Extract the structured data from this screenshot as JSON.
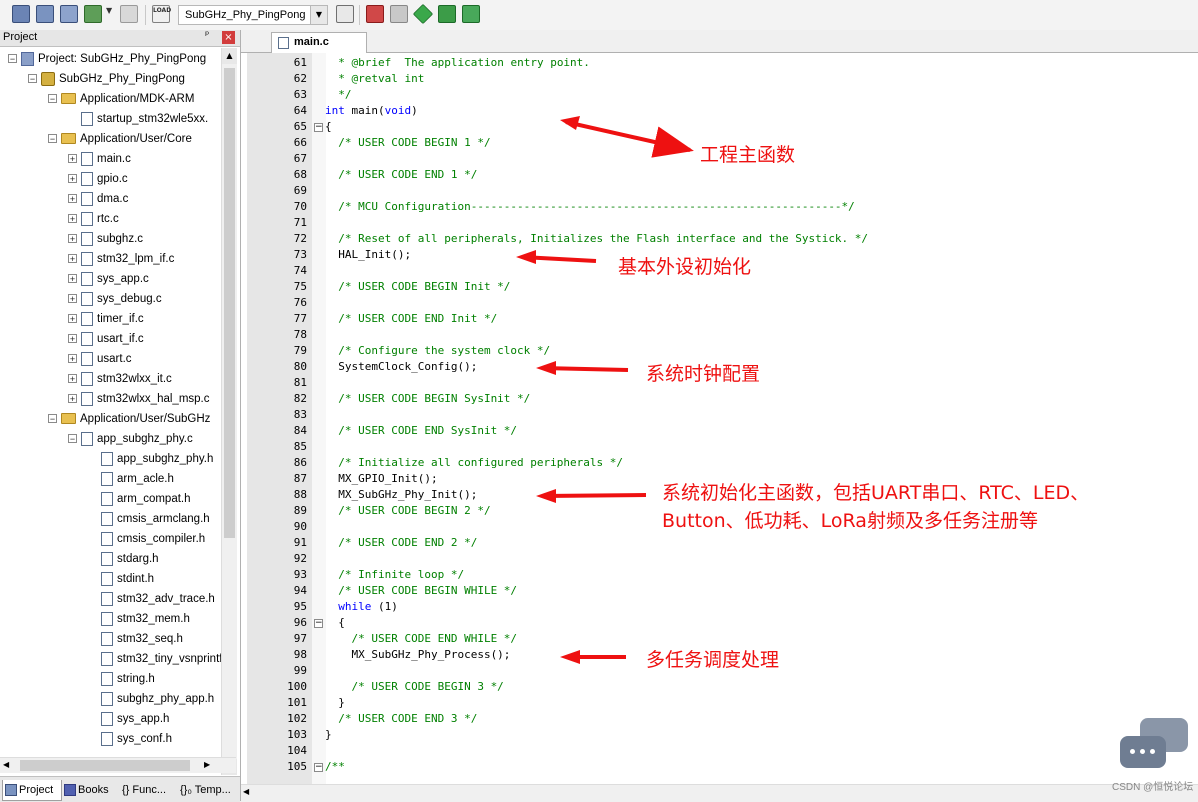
{
  "toolbar": {
    "target_name": "SubGHz_Phy_PingPong",
    "load_label": "LOAD"
  },
  "project_panel": {
    "title": "Project",
    "pin": "ᵖ",
    "close": "×",
    "tree": [
      {
        "label": "Project: SubGHz_Phy_PingPong",
        "level": 0,
        "type": "project",
        "expander": "−"
      },
      {
        "label": "SubGHz_Phy_PingPong",
        "level": 1,
        "type": "group",
        "expander": "−"
      },
      {
        "label": "Application/MDK-ARM",
        "level": 2,
        "type": "folder",
        "expander": "−"
      },
      {
        "label": "startup_stm32wle5xx.",
        "level": 3,
        "type": "file",
        "expander": ""
      },
      {
        "label": "Application/User/Core",
        "level": 2,
        "type": "folder",
        "expander": "−"
      },
      {
        "label": "main.c",
        "level": 3,
        "type": "file",
        "expander": "+"
      },
      {
        "label": "gpio.c",
        "level": 3,
        "type": "file",
        "expander": "+"
      },
      {
        "label": "dma.c",
        "level": 3,
        "type": "file",
        "expander": "+"
      },
      {
        "label": "rtc.c",
        "level": 3,
        "type": "file",
        "expander": "+"
      },
      {
        "label": "subghz.c",
        "level": 3,
        "type": "file",
        "expander": "+"
      },
      {
        "label": "stm32_lpm_if.c",
        "level": 3,
        "type": "file",
        "expander": "+"
      },
      {
        "label": "sys_app.c",
        "level": 3,
        "type": "file",
        "expander": "+"
      },
      {
        "label": "sys_debug.c",
        "level": 3,
        "type": "file",
        "expander": "+"
      },
      {
        "label": "timer_if.c",
        "level": 3,
        "type": "file",
        "expander": "+"
      },
      {
        "label": "usart_if.c",
        "level": 3,
        "type": "file",
        "expander": "+"
      },
      {
        "label": "usart.c",
        "level": 3,
        "type": "file",
        "expander": "+"
      },
      {
        "label": "stm32wlxx_it.c",
        "level": 3,
        "type": "file",
        "expander": "+"
      },
      {
        "label": "stm32wlxx_hal_msp.c",
        "level": 3,
        "type": "file",
        "expander": "+"
      },
      {
        "label": "Application/User/SubGHz",
        "level": 2,
        "type": "folder",
        "expander": "−"
      },
      {
        "label": "app_subghz_phy.c",
        "level": 3,
        "type": "file",
        "expander": "−"
      },
      {
        "label": "app_subghz_phy.h",
        "level": 4,
        "type": "file",
        "expander": ""
      },
      {
        "label": "arm_acle.h",
        "level": 4,
        "type": "file",
        "expander": ""
      },
      {
        "label": "arm_compat.h",
        "level": 4,
        "type": "file",
        "expander": ""
      },
      {
        "label": "cmsis_armclang.h",
        "level": 4,
        "type": "file",
        "expander": ""
      },
      {
        "label": "cmsis_compiler.h",
        "level": 4,
        "type": "file",
        "expander": ""
      },
      {
        "label": "stdarg.h",
        "level": 4,
        "type": "file",
        "expander": ""
      },
      {
        "label": "stdint.h",
        "level": 4,
        "type": "file",
        "expander": ""
      },
      {
        "label": "stm32_adv_trace.h",
        "level": 4,
        "type": "file",
        "expander": ""
      },
      {
        "label": "stm32_mem.h",
        "level": 4,
        "type": "file",
        "expander": ""
      },
      {
        "label": "stm32_seq.h",
        "level": 4,
        "type": "file",
        "expander": ""
      },
      {
        "label": "stm32_tiny_vsnprintf",
        "level": 4,
        "type": "file",
        "expander": ""
      },
      {
        "label": "string.h",
        "level": 4,
        "type": "file",
        "expander": ""
      },
      {
        "label": "subghz_phy_app.h",
        "level": 4,
        "type": "file",
        "expander": ""
      },
      {
        "label": "sys_app.h",
        "level": 4,
        "type": "file",
        "expander": ""
      },
      {
        "label": "sys_conf.h",
        "level": 4,
        "type": "file",
        "expander": ""
      }
    ],
    "bottom_tabs": [
      "Project",
      "Books",
      "{} Func...",
      "{}₀ Temp..."
    ]
  },
  "editor": {
    "tab_label": "main.c",
    "lines": [
      {
        "num": "61",
        "fold": "",
        "segments": [
          {
            "t": "  * ",
            "c": "cmt"
          },
          {
            "t": "@brief",
            "c": "cmt"
          },
          {
            "t": "  The application entry point.",
            "c": "cmt"
          }
        ]
      },
      {
        "num": "62",
        "fold": "",
        "segments": [
          {
            "t": "  * ",
            "c": "cmt"
          },
          {
            "t": "@retval",
            "c": "cmt"
          },
          {
            "t": " int",
            "c": "cmt"
          }
        ]
      },
      {
        "num": "63",
        "fold": "",
        "segments": [
          {
            "t": "  */",
            "c": "cmt"
          }
        ]
      },
      {
        "num": "64",
        "fold": "",
        "segments": [
          {
            "t": "int",
            "c": "kw"
          },
          {
            "t": " main(",
            "c": "plain"
          },
          {
            "t": "void",
            "c": "kw"
          },
          {
            "t": ")",
            "c": "plain"
          }
        ]
      },
      {
        "num": "65",
        "fold": "−",
        "segments": [
          {
            "t": "{",
            "c": "plain"
          }
        ]
      },
      {
        "num": "66",
        "fold": "",
        "segments": [
          {
            "t": "  /* USER CODE BEGIN 1 */",
            "c": "cmt"
          }
        ]
      },
      {
        "num": "67",
        "fold": "",
        "segments": []
      },
      {
        "num": "68",
        "fold": "",
        "segments": [
          {
            "t": "  /* USER CODE END 1 */",
            "c": "cmt"
          }
        ]
      },
      {
        "num": "69",
        "fold": "",
        "segments": []
      },
      {
        "num": "70",
        "fold": "",
        "segments": [
          {
            "t": "  /* MCU Configuration--------------------------------------------------------*/",
            "c": "cmt"
          }
        ]
      },
      {
        "num": "71",
        "fold": "",
        "segments": []
      },
      {
        "num": "72",
        "fold": "",
        "segments": [
          {
            "t": "  /* Reset of all peripherals, Initializes the Flash interface and the Systick. */",
            "c": "cmt"
          }
        ]
      },
      {
        "num": "73",
        "fold": "",
        "segments": [
          {
            "t": "  HAL_Init();",
            "c": "plain"
          }
        ]
      },
      {
        "num": "74",
        "fold": "",
        "segments": []
      },
      {
        "num": "75",
        "fold": "",
        "segments": [
          {
            "t": "  /* USER CODE BEGIN Init */",
            "c": "cmt"
          }
        ]
      },
      {
        "num": "76",
        "fold": "",
        "segments": []
      },
      {
        "num": "77",
        "fold": "",
        "segments": [
          {
            "t": "  /* USER CODE END Init */",
            "c": "cmt"
          }
        ]
      },
      {
        "num": "78",
        "fold": "",
        "segments": []
      },
      {
        "num": "79",
        "fold": "",
        "segments": [
          {
            "t": "  /* Configure the system clock */",
            "c": "cmt"
          }
        ]
      },
      {
        "num": "80",
        "fold": "",
        "segments": [
          {
            "t": "  SystemClock_Config();",
            "c": "plain"
          }
        ]
      },
      {
        "num": "81",
        "fold": "",
        "segments": []
      },
      {
        "num": "82",
        "fold": "",
        "segments": [
          {
            "t": "  /* USER CODE BEGIN SysInit */",
            "c": "cmt"
          }
        ]
      },
      {
        "num": "83",
        "fold": "",
        "segments": []
      },
      {
        "num": "84",
        "fold": "",
        "segments": [
          {
            "t": "  /* USER CODE END SysInit */",
            "c": "cmt"
          }
        ]
      },
      {
        "num": "85",
        "fold": "",
        "segments": []
      },
      {
        "num": "86",
        "fold": "",
        "segments": [
          {
            "t": "  /* Initialize all configured peripherals */",
            "c": "cmt"
          }
        ]
      },
      {
        "num": "87",
        "fold": "",
        "segments": [
          {
            "t": "  MX_GPIO_Init();",
            "c": "plain"
          }
        ]
      },
      {
        "num": "88",
        "fold": "",
        "segments": [
          {
            "t": "  MX_SubGHz_Phy_Init();",
            "c": "plain"
          }
        ]
      },
      {
        "num": "89",
        "fold": "",
        "segments": [
          {
            "t": "  /* USER CODE BEGIN 2 */",
            "c": "cmt"
          }
        ]
      },
      {
        "num": "90",
        "fold": "",
        "segments": []
      },
      {
        "num": "91",
        "fold": "",
        "segments": [
          {
            "t": "  /* USER CODE END 2 */",
            "c": "cmt"
          }
        ]
      },
      {
        "num": "92",
        "fold": "",
        "segments": []
      },
      {
        "num": "93",
        "fold": "",
        "segments": [
          {
            "t": "  /* Infinite loop */",
            "c": "cmt"
          }
        ]
      },
      {
        "num": "94",
        "fold": "",
        "segments": [
          {
            "t": "  /* USER CODE BEGIN WHILE */",
            "c": "cmt"
          }
        ]
      },
      {
        "num": "95",
        "fold": "",
        "segments": [
          {
            "t": "  ",
            "c": "plain"
          },
          {
            "t": "while",
            "c": "kw"
          },
          {
            "t": " (1)",
            "c": "plain"
          }
        ]
      },
      {
        "num": "96",
        "fold": "−",
        "segments": [
          {
            "t": "  {",
            "c": "plain"
          }
        ]
      },
      {
        "num": "97",
        "fold": "",
        "segments": [
          {
            "t": "    /* USER CODE END WHILE */",
            "c": "cmt"
          }
        ]
      },
      {
        "num": "98",
        "fold": "",
        "segments": [
          {
            "t": "    MX_SubGHz_Phy_Process();",
            "c": "plain"
          }
        ]
      },
      {
        "num": "99",
        "fold": "",
        "segments": []
      },
      {
        "num": "100",
        "fold": "",
        "segments": [
          {
            "t": "    /* USER CODE BEGIN 3 */",
            "c": "cmt"
          }
        ]
      },
      {
        "num": "101",
        "fold": "",
        "segments": [
          {
            "t": "  }",
            "c": "plain"
          }
        ]
      },
      {
        "num": "102",
        "fold": "",
        "segments": [
          {
            "t": "  /* USER CODE END 3 */",
            "c": "cmt"
          }
        ]
      },
      {
        "num": "103",
        "fold": "",
        "segments": [
          {
            "t": "}",
            "c": "plain"
          }
        ]
      },
      {
        "num": "104",
        "fold": "",
        "segments": []
      },
      {
        "num": "105",
        "fold": "−",
        "segments": [
          {
            "t": "/**",
            "c": "cmt"
          }
        ]
      }
    ]
  },
  "annotations": [
    {
      "text": "工程主函数",
      "line": "64"
    },
    {
      "text": "基本外设初始化",
      "line": "73"
    },
    {
      "text": "系统时钟配置",
      "line": "80"
    },
    {
      "text": "系统初始化主函数，包括UART串口、RTC、LED、",
      "line": "88"
    },
    {
      "text": "Button、低功耗、LoRa射频及多任务注册等",
      "line": "89"
    },
    {
      "text": "多任务调度处理",
      "line": "98"
    }
  ],
  "watermark": "CSDN @恒悦论坛",
  "colors": {
    "comment": "#008000",
    "keyword": "#0000ff",
    "annotation": "#ee1111",
    "gutter": "#e6e6e6"
  }
}
